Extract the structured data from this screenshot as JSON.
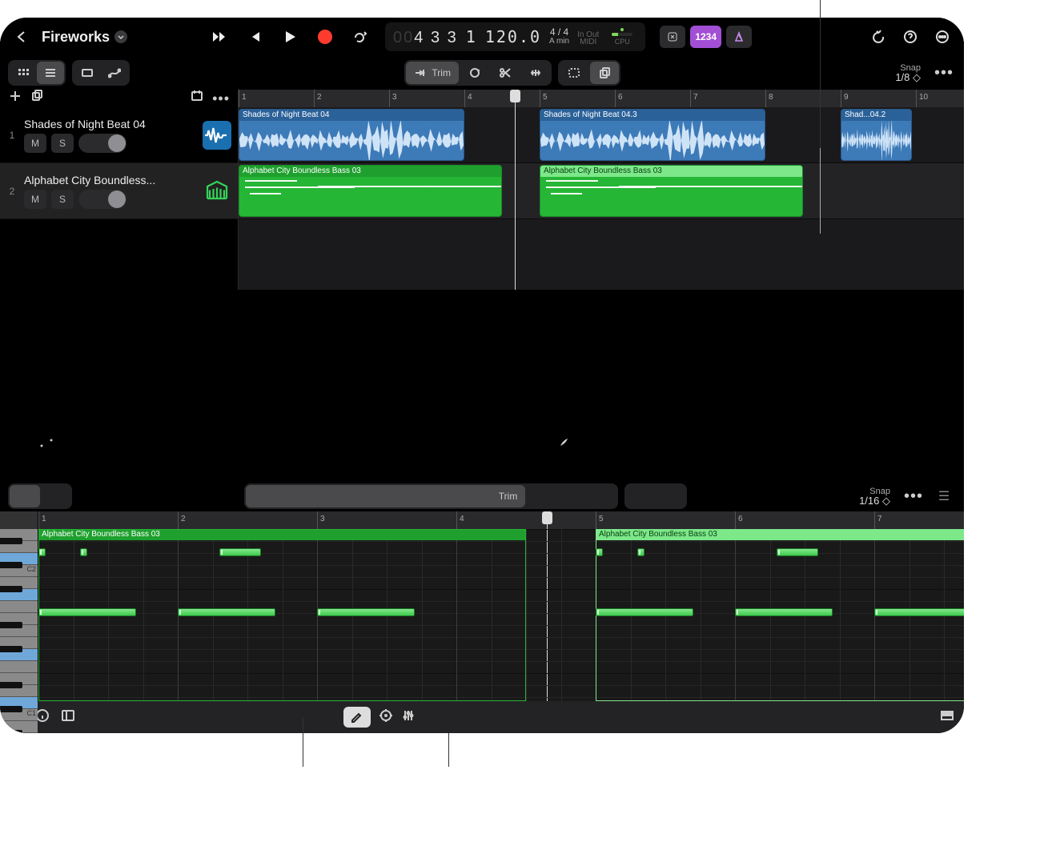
{
  "project": {
    "name": "Fireworks"
  },
  "lcd": {
    "dim_prefix": "00",
    "position": "4 3 3",
    "division": "1",
    "tempo": "120.0",
    "timesig": "4 / 4",
    "key": "A min",
    "midi_label": "MIDI",
    "io_label": "In   Out",
    "cpu_label": "CPU"
  },
  "mode_pill": "1234",
  "toolbar": {
    "trim_label": "Trim",
    "snap_label": "Snap",
    "snap_value": "1/8"
  },
  "tracks": [
    {
      "num": "1",
      "name": "Shades of Night Beat 04",
      "mute": "M",
      "solo": "S",
      "type": "audio"
    },
    {
      "num": "2",
      "name": "Alphabet City Boundless...",
      "mute": "M",
      "solo": "S",
      "type": "midi"
    }
  ],
  "ruler_bars": [
    "1",
    "2",
    "3",
    "4",
    "5",
    "6",
    "7",
    "8",
    "9",
    "10"
  ],
  "regions_audio": [
    {
      "label": "Shades of Night Beat 04",
      "start": 0,
      "len": 3
    },
    {
      "label": "Shades of Night Beat 04.3",
      "start": 4,
      "len": 3
    },
    {
      "label": "Shad...04.2",
      "start": 8,
      "len": 0.95
    }
  ],
  "regions_midi": [
    {
      "label": "Alphabet City Boundless Bass 03",
      "start": 0,
      "len": 3.5,
      "sel": false
    },
    {
      "label": "Alphabet City Boundless Bass 03",
      "start": 4,
      "len": 3.5,
      "sel": true
    }
  ],
  "editor": {
    "trim_label": "Trim",
    "snap_label": "Snap",
    "snap_value": "1/16",
    "ruler_bars": [
      "1",
      "2",
      "3",
      "4",
      "5",
      "6",
      "7"
    ],
    "region1_label": "Alphabet City Boundless Bass 03",
    "region2_label": "Alphabet City Boundless Bass 03",
    "key_labels": {
      "c1": "C1",
      "c2": "C2"
    }
  },
  "colors": {
    "audio": "#3d7ab8",
    "midi": "#26b636",
    "accent": "#a24fd6",
    "record": "#ff3b30"
  }
}
